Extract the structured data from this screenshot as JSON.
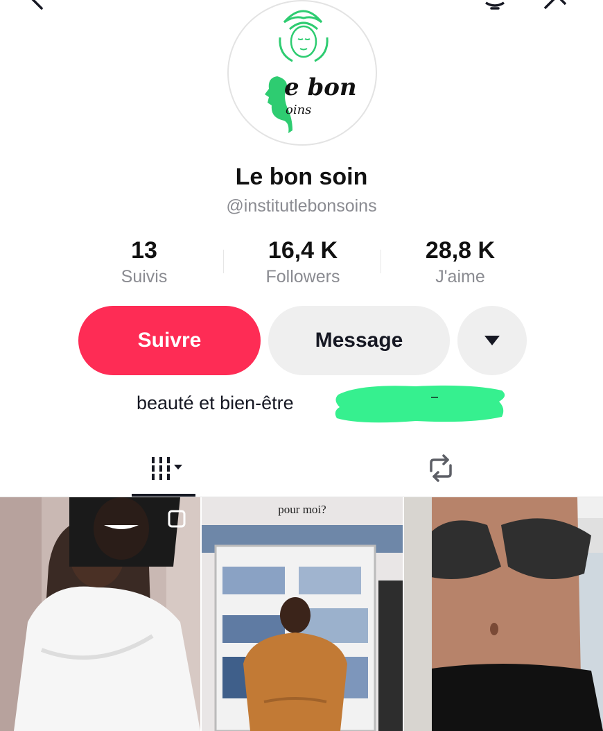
{
  "profile": {
    "logo_text_top": "e bon",
    "logo_text_bottom": "oins",
    "display_name": "Le bon soin",
    "username": "@institutlebonsoins",
    "bio": "beauté et bien-être"
  },
  "stats": [
    {
      "value": "13",
      "label": "Suivis"
    },
    {
      "value": "16,4 K",
      "label": "Followers"
    },
    {
      "value": "28,8 K",
      "label": "J'aime"
    }
  ],
  "actions": {
    "follow_label": "Suivre",
    "message_label": "Message",
    "more_icon": "caret-down-icon"
  },
  "tabs": [
    {
      "icon": "videos-grid-icon",
      "selected": true
    },
    {
      "icon": "repost-icon",
      "selected": false
    }
  ],
  "videos": [
    {
      "overlay_text": ""
    },
    {
      "overlay_text": "pour moi?"
    },
    {
      "overlay_text": ""
    }
  ],
  "colors": {
    "follow_button": "#fe2c55",
    "secondary_button": "#efefef",
    "brand_green": "#2ecc71",
    "redaction": "#36f08f"
  }
}
